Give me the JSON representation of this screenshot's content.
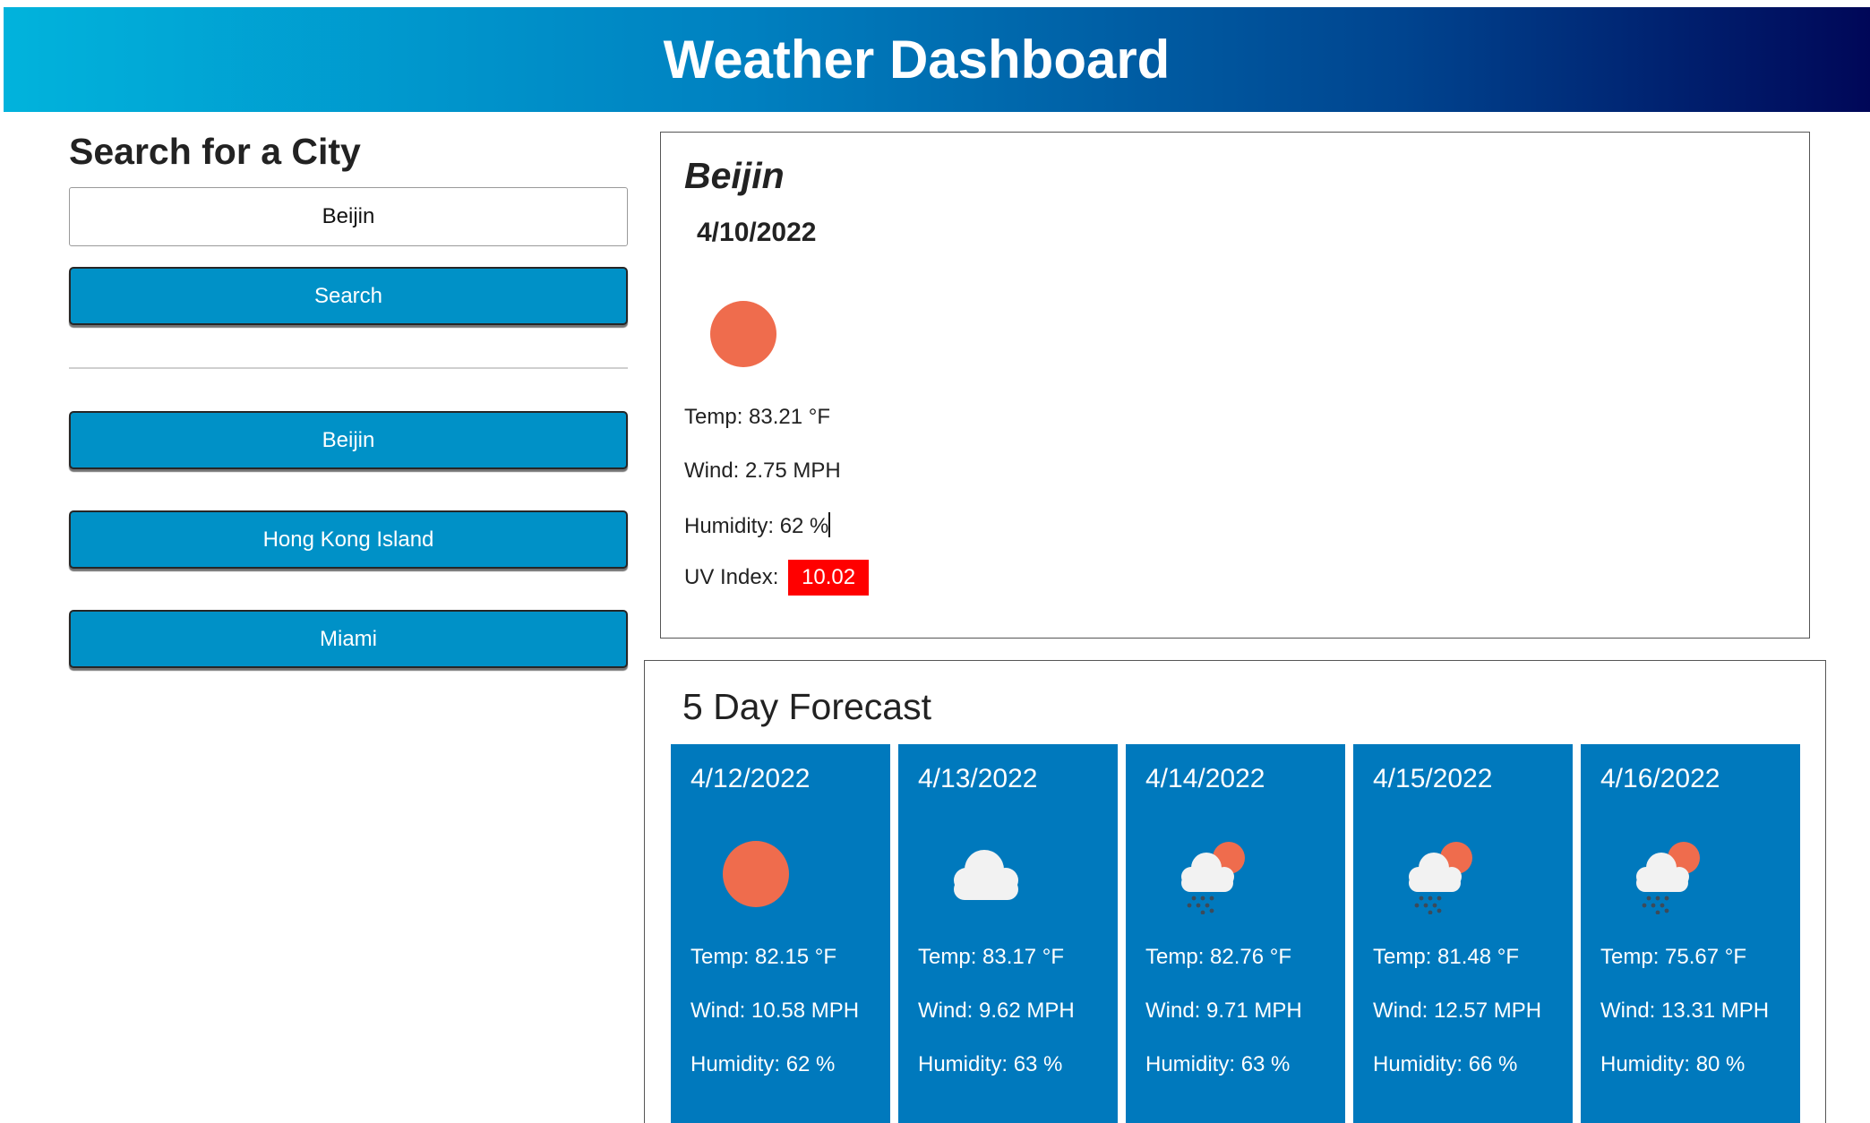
{
  "header": {
    "title": "Weather Dashboard"
  },
  "search": {
    "title": "Search for a City",
    "input_value": "Beijin",
    "button_label": "Search"
  },
  "history": [
    {
      "label": "Beijin"
    },
    {
      "label": "Hong Kong Island"
    },
    {
      "label": "Miami"
    }
  ],
  "current": {
    "city": "Beijin",
    "date": "4/10/2022",
    "icon": "sun-icon",
    "temp": "Temp: 83.21 °F",
    "wind": "Wind: 2.75 MPH",
    "humidity": "Humidity: 62 %",
    "uv_label": "UV Index: ",
    "uv_value": "10.02",
    "uv_color": "#ff0000"
  },
  "forecast": {
    "title": "5 Day Forecast",
    "days": [
      {
        "date": "4/12/2022",
        "icon": "sun-icon",
        "temp": "Temp: 82.15 °F",
        "wind": "Wind: 10.58 MPH",
        "humidity": "Humidity: 62 %"
      },
      {
        "date": "4/13/2022",
        "icon": "cloud-icon",
        "temp": "Temp: 83.17 °F",
        "wind": "Wind: 9.62 MPH",
        "humidity": "Humidity: 63 %"
      },
      {
        "date": "4/14/2022",
        "icon": "rain-sun-cloud-icon",
        "temp": "Temp: 82.76 °F",
        "wind": "Wind: 9.71 MPH",
        "humidity": "Humidity: 63 %"
      },
      {
        "date": "4/15/2022",
        "icon": "rain-sun-cloud-icon",
        "temp": "Temp: 81.48 °F",
        "wind": "Wind: 12.57 MPH",
        "humidity": "Humidity: 66 %"
      },
      {
        "date": "4/16/2022",
        "icon": "rain-sun-cloud-icon",
        "temp": "Temp: 75.67 °F",
        "wind": "Wind: 13.31 MPH",
        "humidity": "Humidity: 80 %"
      }
    ]
  },
  "colors": {
    "header_gradient_start": "#01b3dc",
    "header_gradient_end": "#000758",
    "button_bg": "#0091c7",
    "forecast_card_bg": "#0079bd",
    "sun": "#ef6c4d"
  }
}
